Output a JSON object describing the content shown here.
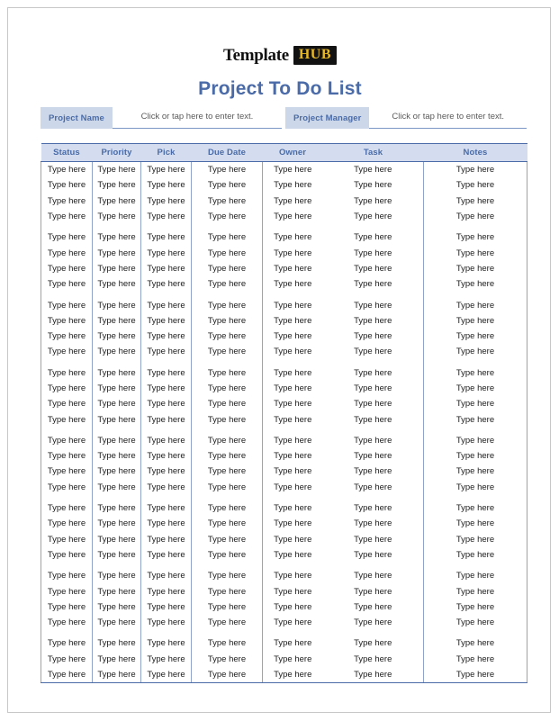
{
  "brand": {
    "name_primary": "Template",
    "name_badge": "HUB",
    "badge_bg": "#121212",
    "badge_color": "#e8b824"
  },
  "header": {
    "title": "Project To Do List",
    "title_color": "#4a6ba8"
  },
  "meta": {
    "fields": [
      {
        "label": "Project Name",
        "placeholder": "Click or tap here to enter text.",
        "value": ""
      },
      {
        "label": "Project Manager",
        "placeholder": "Click or tap here to enter text.",
        "value": ""
      }
    ],
    "label_bg": "#ccd8ea",
    "label_color": "#4a6ba8"
  },
  "table": {
    "header_bg": "#d3ddef",
    "header_color": "#4a6ba8",
    "border_color": "#4a6ba8",
    "cell_border_color": "#8ea4c8",
    "columns": [
      "Status",
      "Priority",
      "Pick",
      "Due Date",
      "Owner",
      "Task",
      "Notes"
    ],
    "cell_placeholder": "Type here",
    "row_count": 31,
    "spacer_after_rows": [
      4,
      8,
      12,
      16,
      20,
      24,
      28
    ],
    "rows": [
      [
        "Type here",
        "Type here",
        "Type here",
        "Type here",
        "Type here",
        "Type here",
        "Type here"
      ],
      [
        "Type here",
        "Type here",
        "Type here",
        "Type here",
        "Type here",
        "Type here",
        "Type here"
      ],
      [
        "Type here",
        "Type here",
        "Type here",
        "Type here",
        "Type here",
        "Type here",
        "Type here"
      ],
      [
        "Type here",
        "Type here",
        "Type here",
        "Type here",
        "Type here",
        "Type here",
        "Type here"
      ],
      [
        "Type here",
        "Type here",
        "Type here",
        "Type here",
        "Type here",
        "Type here",
        "Type here"
      ],
      [
        "Type here",
        "Type here",
        "Type here",
        "Type here",
        "Type here",
        "Type here",
        "Type here"
      ],
      [
        "Type here",
        "Type here",
        "Type here",
        "Type here",
        "Type here",
        "Type here",
        "Type here"
      ],
      [
        "Type here",
        "Type here",
        "Type here",
        "Type here",
        "Type here",
        "Type here",
        "Type here"
      ],
      [
        "Type here",
        "Type here",
        "Type here",
        "Type here",
        "Type here",
        "Type here",
        "Type here"
      ],
      [
        "Type here",
        "Type here",
        "Type here",
        "Type here",
        "Type here",
        "Type here",
        "Type here"
      ],
      [
        "Type here",
        "Type here",
        "Type here",
        "Type here",
        "Type here",
        "Type here",
        "Type here"
      ],
      [
        "Type here",
        "Type here",
        "Type here",
        "Type here",
        "Type here",
        "Type here",
        "Type here"
      ],
      [
        "Type here",
        "Type here",
        "Type here",
        "Type here",
        "Type here",
        "Type here",
        "Type here"
      ],
      [
        "Type here",
        "Type here",
        "Type here",
        "Type here",
        "Type here",
        "Type here",
        "Type here"
      ],
      [
        "Type here",
        "Type here",
        "Type here",
        "Type here",
        "Type here",
        "Type here",
        "Type here"
      ],
      [
        "Type here",
        "Type here",
        "Type here",
        "Type here",
        "Type here",
        "Type here",
        "Type here"
      ],
      [
        "Type here",
        "Type here",
        "Type here",
        "Type here",
        "Type here",
        "Type here",
        "Type here"
      ],
      [
        "Type here",
        "Type here",
        "Type here",
        "Type here",
        "Type here",
        "Type here",
        "Type here"
      ],
      [
        "Type here",
        "Type here",
        "Type here",
        "Type here",
        "Type here",
        "Type here",
        "Type here"
      ],
      [
        "Type here",
        "Type here",
        "Type here",
        "Type here",
        "Type here",
        "Type here",
        "Type here"
      ],
      [
        "Type here",
        "Type here",
        "Type here",
        "Type here",
        "Type here",
        "Type here",
        "Type here"
      ],
      [
        "Type here",
        "Type here",
        "Type here",
        "Type here",
        "Type here",
        "Type here",
        "Type here"
      ],
      [
        "Type here",
        "Type here",
        "Type here",
        "Type here",
        "Type here",
        "Type here",
        "Type here"
      ],
      [
        "Type here",
        "Type here",
        "Type here",
        "Type here",
        "Type here",
        "Type here",
        "Type here"
      ],
      [
        "Type here",
        "Type here",
        "Type here",
        "Type here",
        "Type here",
        "Type here",
        "Type here"
      ],
      [
        "Type here",
        "Type here",
        "Type here",
        "Type here",
        "Type here",
        "Type here",
        "Type here"
      ],
      [
        "Type here",
        "Type here",
        "Type here",
        "Type here",
        "Type here",
        "Type here",
        "Type here"
      ],
      [
        "Type here",
        "Type here",
        "Type here",
        "Type here",
        "Type here",
        "Type here",
        "Type here"
      ],
      [
        "Type here",
        "Type here",
        "Type here",
        "Type here",
        "Type here",
        "Type here",
        "Type here"
      ],
      [
        "Type here",
        "Type here",
        "Type here",
        "Type here",
        "Type here",
        "Type here",
        "Type here"
      ],
      [
        "Type here",
        "Type here",
        "Type here",
        "Type here",
        "Type here",
        "Type here",
        "Type here"
      ]
    ]
  }
}
